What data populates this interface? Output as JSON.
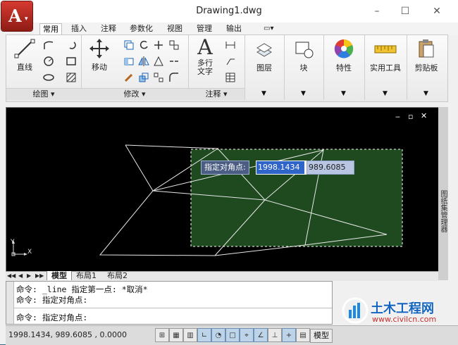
{
  "window": {
    "title": "Drawing1.dwg",
    "minimize": "–",
    "maximize": "☐",
    "close": "✕"
  },
  "tabs": [
    "常用",
    "插入",
    "注释",
    "参数化",
    "视图",
    "管理",
    "输出"
  ],
  "ribbon": {
    "line_label": "直线",
    "move_label": "移动",
    "mtext_label": "多行\n文字",
    "mtext_line1": "多行",
    "mtext_line2": "文字",
    "layers_label": "图层",
    "block_label": "块",
    "properties_label": "特性",
    "utilities_label": "实用工具",
    "clipboard_label": "剪贴板",
    "panel_draw": "绘图 ▾",
    "panel_modify": "修改 ▾",
    "panel_annotate": "注释 ▾"
  },
  "drawing": {
    "viewport_controls": [
      "‒",
      "▫",
      "✕"
    ],
    "ucs_y": "Y",
    "ucs_x": "X",
    "dynamic_input": {
      "prompt": "指定对角点:",
      "x_value": "1998.1434",
      "y_value": "989.6085"
    }
  },
  "layout_tabs": {
    "nav": [
      "◀◀",
      "◀",
      "▶",
      "▶▶"
    ],
    "model": "模型",
    "layout1": "布局1",
    "layout2": "布局2"
  },
  "right_panel": {
    "label": "图纸集管理器"
  },
  "command": {
    "line1": "命令:  _line 指定第一点: *取消*",
    "line2": "命令: 指定对角点:",
    "line3": "命令: 指定对角点:"
  },
  "status": {
    "coords": "1998.1434, 989.6085 , 0.0000",
    "model": "模型"
  },
  "watermark": {
    "brand": "土木工程网",
    "url": "www.civilcn.com"
  },
  "colors": {
    "accent_red": "#c0302a",
    "selection_green": "#1f4a1f",
    "dyn_input_blue": "#2f64c8"
  }
}
